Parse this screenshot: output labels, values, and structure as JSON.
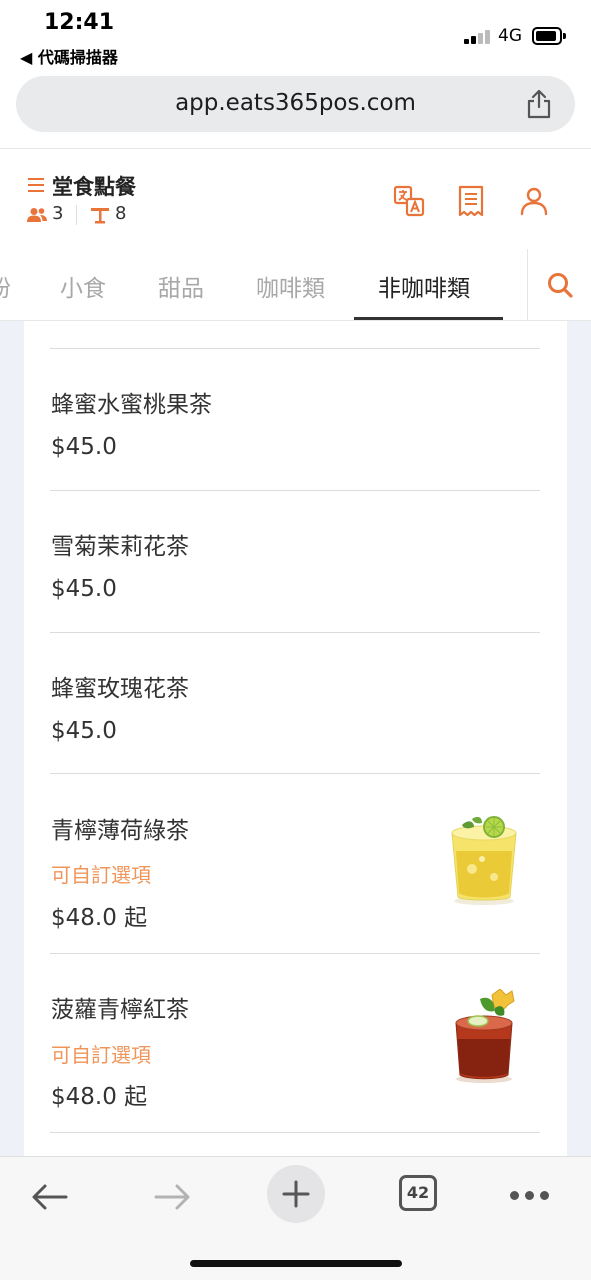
{
  "status": {
    "time": "12:41",
    "back_app": "◀ 代碼掃描器",
    "network": "4G"
  },
  "browser": {
    "url": "app.eats365pos.com",
    "tab_count": "42"
  },
  "header": {
    "title": "堂食點餐",
    "people_count": "3",
    "table_number": "8",
    "icons": [
      "translate-icon",
      "receipt-icon",
      "user-icon"
    ]
  },
  "tabs": {
    "items": [
      {
        "label": "粉",
        "active": false
      },
      {
        "label": "小食",
        "active": false
      },
      {
        "label": "甜品",
        "active": false
      },
      {
        "label": "咖啡類",
        "active": false
      },
      {
        "label": "非咖啡類",
        "active": true
      }
    ]
  },
  "menu": {
    "items": [
      {
        "name": "蜂蜜水蜜桃果茶",
        "price": "$45.0",
        "custom": null,
        "image": null
      },
      {
        "name": "雪菊茉莉花茶",
        "price": "$45.0",
        "custom": null,
        "image": null
      },
      {
        "name": "蜂蜜玫瑰花茶",
        "price": "$45.0",
        "custom": null,
        "image": null
      },
      {
        "name": "青檸薄荷綠茶",
        "price": "$48.0 起",
        "custom": "可自訂選項",
        "image": "green-tea-drink"
      },
      {
        "name": "菠蘿青檸紅茶",
        "price": "$48.0 起",
        "custom": "可自訂選項",
        "image": "black-tea-drink"
      }
    ]
  },
  "colors": {
    "accent": "#e8743a",
    "custom_text": "#f0955a",
    "content_bg": "#eef1f7"
  }
}
